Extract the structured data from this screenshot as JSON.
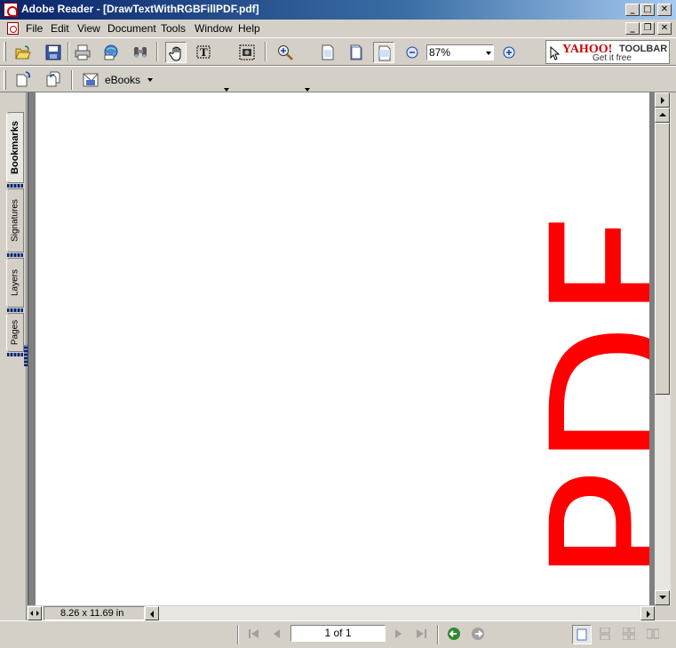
{
  "window": {
    "title": "Adobe Reader - [DrawTextWithRGBFillPDF.pdf]",
    "controls": {
      "minimize": "_",
      "maximize": "□",
      "close": "✕",
      "doc_minimize": "_",
      "doc_restore": "❐",
      "doc_close": "✕"
    }
  },
  "menu": {
    "items": [
      {
        "label": "File"
      },
      {
        "label": "Edit"
      },
      {
        "label": "View"
      },
      {
        "label": "Document"
      },
      {
        "label": "Tools"
      },
      {
        "label": "Window"
      },
      {
        "label": "Help"
      }
    ]
  },
  "toolbar": {
    "icons": [
      "open-icon",
      "save-icon",
      "print-icon",
      "email-icon",
      "search-icon",
      "hand-tool-icon",
      "select-text-icon",
      "snapshot-icon",
      "zoom-in-tool-icon",
      "actual-size-icon",
      "fit-page-icon",
      "fit-width-icon",
      "zoom-out-icon",
      "zoom-in-icon"
    ],
    "zoom_value": "87%",
    "ebooks_label": "eBooks"
  },
  "yahoo": {
    "logo": "YAHOO!",
    "toolbar": "TOOLBAR",
    "tagline": "Get it free"
  },
  "side_tabs": [
    {
      "label": "Bookmarks",
      "active": true
    },
    {
      "label": "Signatures",
      "active": false
    },
    {
      "label": "Layers",
      "active": false
    },
    {
      "label": "Pages",
      "active": false
    }
  ],
  "document": {
    "text": "PDF",
    "text_color": "#ff0000",
    "page_size": "8.26 x 11.69 in"
  },
  "navigation": {
    "page_indicator": "1 of 1"
  },
  "colors": {
    "titlebar_start": "#0a246a",
    "chrome": "#d4d0c8",
    "document_text": "#ff0000"
  }
}
